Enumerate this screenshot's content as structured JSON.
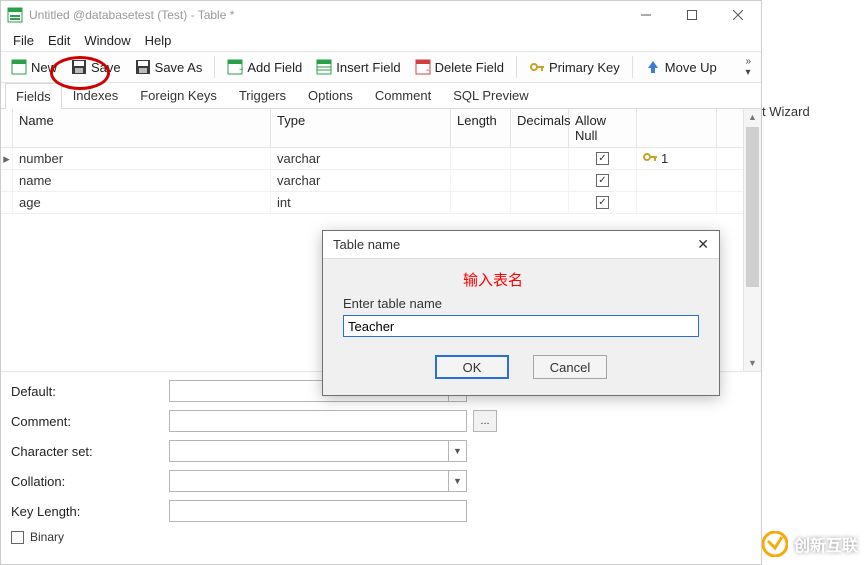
{
  "titlebar": {
    "title": "Untitled @databasetest (Test) - Table *"
  },
  "menubar": [
    "File",
    "Edit",
    "Window",
    "Help"
  ],
  "toolbar": {
    "new": "New",
    "save": "Save",
    "save_as": "Save As",
    "add_field": "Add Field",
    "insert_field": "Insert Field",
    "delete_field": "Delete Field",
    "primary_key": "Primary Key",
    "move_up": "Move Up"
  },
  "tabs": [
    "Fields",
    "Indexes",
    "Foreign Keys",
    "Triggers",
    "Options",
    "Comment",
    "SQL Preview"
  ],
  "active_tab": 0,
  "grid": {
    "columns": [
      "Name",
      "Type",
      "Length",
      "Decimals",
      "Allow Null",
      ""
    ],
    "rows": [
      {
        "name": "number",
        "type": "varchar",
        "length": "",
        "decimals": "",
        "allow_null": true,
        "key": "1",
        "current": true
      },
      {
        "name": "name",
        "type": "varchar",
        "length": "",
        "decimals": "",
        "allow_null": true,
        "key": "",
        "current": false
      },
      {
        "name": "age",
        "type": "int",
        "length": "",
        "decimals": "",
        "allow_null": true,
        "key": "",
        "current": false
      }
    ]
  },
  "props": {
    "default_label": "Default:",
    "comment_label": "Comment:",
    "charset_label": "Character set:",
    "collation_label": "Collation:",
    "keylen_label": "Key Length:",
    "binary_label": "Binary",
    "ellipsis": "..."
  },
  "dialog": {
    "title": "Table name",
    "hint": "输入表名",
    "field_label": "Enter table name",
    "value": "Teacher",
    "ok": "OK",
    "cancel": "Cancel"
  },
  "outside": {
    "wizard": "t Wizard",
    "watermark": "创新互联"
  }
}
